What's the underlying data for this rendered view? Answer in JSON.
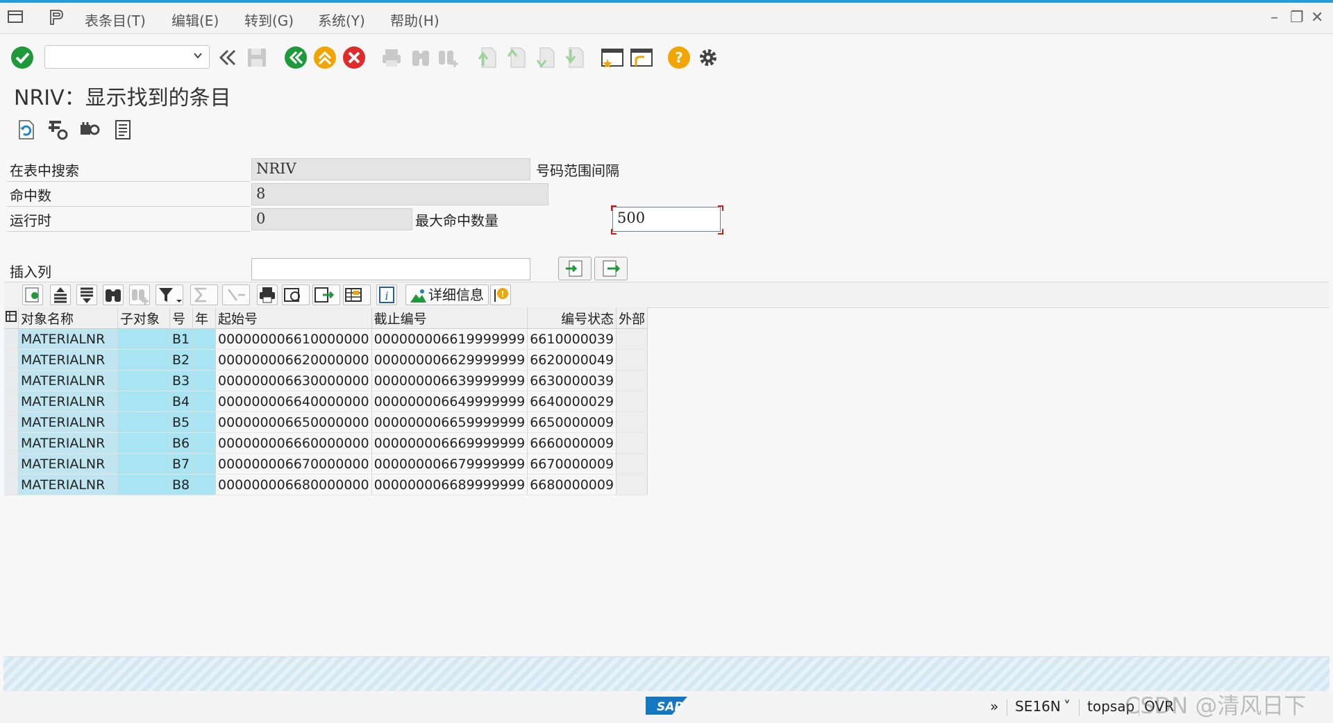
{
  "menu": {
    "items": [
      "表条目(T)",
      "编辑(E)",
      "转到(G)",
      "系统(Y)",
      "帮助(H)"
    ]
  },
  "window": {
    "minimize": "–",
    "restore": "❐",
    "close": "✕"
  },
  "command_field": {
    "value": ""
  },
  "title": "NRIV：显示找到的条目",
  "selection": {
    "table_label": "在表中搜索",
    "table_value": "NRIV",
    "table_desc": "号码范围间隔",
    "hits_label": "命中数",
    "hits_value": "8",
    "runtime_label": "运行时",
    "runtime_value": "0",
    "maxhits_label": "最大命中数量",
    "maxhits_value": "500",
    "insert_label": "插入列"
  },
  "alv": {
    "detail_label": "详细信息"
  },
  "grid": {
    "columns": [
      "对象名称",
      "子对象",
      "号",
      "年",
      "起始号",
      "截止编号",
      "编号状态",
      "外部"
    ],
    "rows": [
      [
        "MATERIALNR",
        "",
        "B1",
        "",
        "000000006610000000",
        "000000006619999999",
        "6610000039",
        ""
      ],
      [
        "MATERIALNR",
        "",
        "B2",
        "",
        "000000006620000000",
        "000000006629999999",
        "6620000049",
        ""
      ],
      [
        "MATERIALNR",
        "",
        "B3",
        "",
        "000000006630000000",
        "000000006639999999",
        "6630000039",
        ""
      ],
      [
        "MATERIALNR",
        "",
        "B4",
        "",
        "000000006640000000",
        "000000006649999999",
        "6640000029",
        ""
      ],
      [
        "MATERIALNR",
        "",
        "B5",
        "",
        "000000006650000000",
        "000000006659999999",
        "6650000009",
        ""
      ],
      [
        "MATERIALNR",
        "",
        "B6",
        "",
        "000000006660000000",
        "000000006669999999",
        "6660000009",
        ""
      ],
      [
        "MATERIALNR",
        "",
        "B7",
        "",
        "000000006670000000",
        "000000006679999999",
        "6670000009",
        ""
      ],
      [
        "MATERIALNR",
        "",
        "B8",
        "",
        "000000006680000000",
        "000000006689999999",
        "6680000009",
        ""
      ]
    ]
  },
  "status": {
    "more": "»",
    "tcode": "SE16N",
    "tcode_chevron": "˅",
    "server": "topsap",
    "mode": "OVR",
    "logo": "SAP"
  },
  "watermark": "CSDN @清风日下"
}
